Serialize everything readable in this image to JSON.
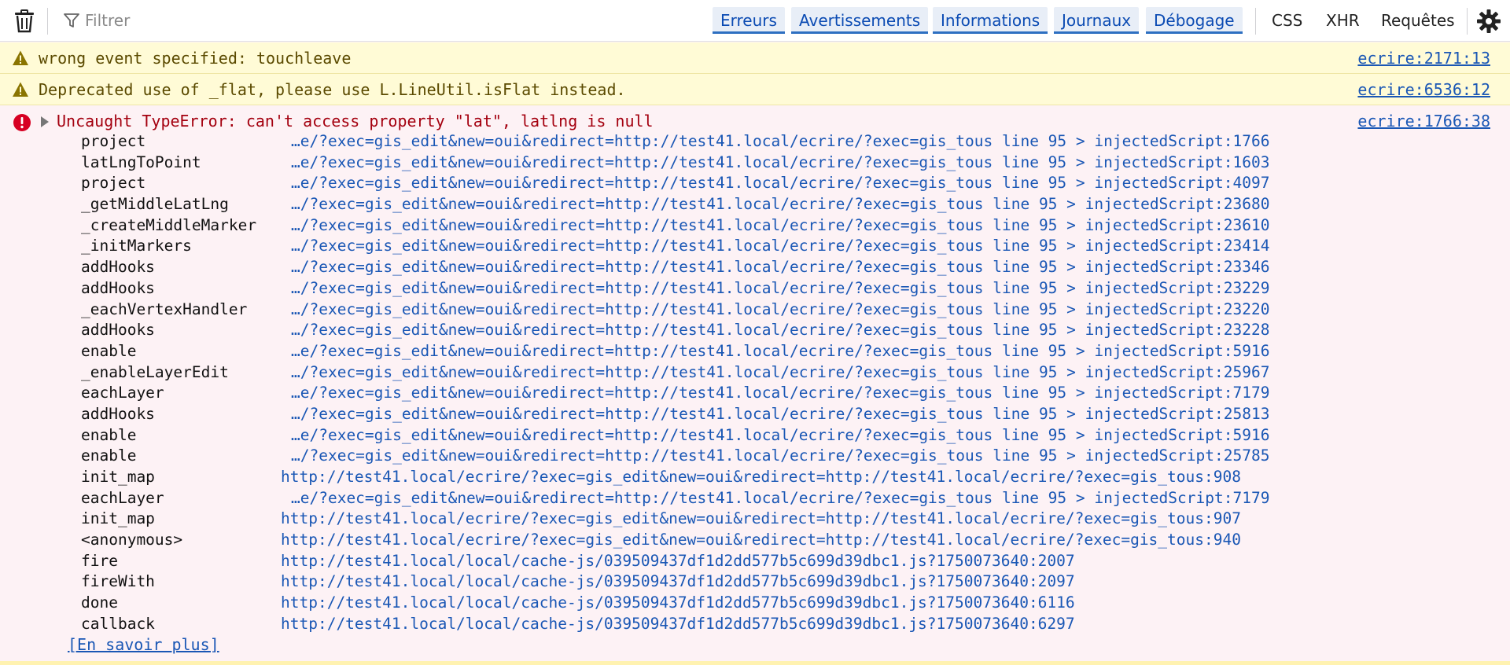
{
  "toolbar": {
    "filter_placeholder": "Filtrer",
    "tabs": [
      "Erreurs",
      "Avertissements",
      "Informations",
      "Journaux",
      "Débogage"
    ],
    "extras": [
      "CSS",
      "XHR",
      "Requêtes"
    ]
  },
  "messages": [
    {
      "type": "warning",
      "text": "wrong event specified: touchleave",
      "location": "ecrire:2171:13"
    },
    {
      "type": "warning",
      "text": "Deprecated use of _flat, please use L.LineUtil.isFlat instead.",
      "location": "ecrire:6536:12"
    }
  ],
  "error": {
    "text": "Uncaught TypeError: can't access property \"lat\", latlng is null",
    "location": "ecrire:1766:38",
    "frames": [
      {
        "fn": "project",
        "src": "…e/?exec=gis_edit&new=oui&redirect=http://test41.local/ecrire/?exec=gis_tous line 95 > injectedScript:1766"
      },
      {
        "fn": "latLngToPoint",
        "src": "…e/?exec=gis_edit&new=oui&redirect=http://test41.local/ecrire/?exec=gis_tous line 95 > injectedScript:1603"
      },
      {
        "fn": "project",
        "src": "…e/?exec=gis_edit&new=oui&redirect=http://test41.local/ecrire/?exec=gis_tous line 95 > injectedScript:4097"
      },
      {
        "fn": "_getMiddleLatLng",
        "src": "…/?exec=gis_edit&new=oui&redirect=http://test41.local/ecrire/?exec=gis_tous line 95 > injectedScript:23680"
      },
      {
        "fn": "_createMiddleMarker",
        "src": "…/?exec=gis_edit&new=oui&redirect=http://test41.local/ecrire/?exec=gis_tous line 95 > injectedScript:23610"
      },
      {
        "fn": "_initMarkers",
        "src": "…/?exec=gis_edit&new=oui&redirect=http://test41.local/ecrire/?exec=gis_tous line 95 > injectedScript:23414"
      },
      {
        "fn": "addHooks",
        "src": "…/?exec=gis_edit&new=oui&redirect=http://test41.local/ecrire/?exec=gis_tous line 95 > injectedScript:23346"
      },
      {
        "fn": "addHooks",
        "src": "…/?exec=gis_edit&new=oui&redirect=http://test41.local/ecrire/?exec=gis_tous line 95 > injectedScript:23229"
      },
      {
        "fn": "_eachVertexHandler",
        "src": "…/?exec=gis_edit&new=oui&redirect=http://test41.local/ecrire/?exec=gis_tous line 95 > injectedScript:23220"
      },
      {
        "fn": "addHooks",
        "src": "…/?exec=gis_edit&new=oui&redirect=http://test41.local/ecrire/?exec=gis_tous line 95 > injectedScript:23228"
      },
      {
        "fn": "enable",
        "src": "…e/?exec=gis_edit&new=oui&redirect=http://test41.local/ecrire/?exec=gis_tous line 95 > injectedScript:5916"
      },
      {
        "fn": "_enableLayerEdit",
        "src": "…/?exec=gis_edit&new=oui&redirect=http://test41.local/ecrire/?exec=gis_tous line 95 > injectedScript:25967"
      },
      {
        "fn": "eachLayer",
        "src": "…e/?exec=gis_edit&new=oui&redirect=http://test41.local/ecrire/?exec=gis_tous line 95 > injectedScript:7179"
      },
      {
        "fn": "addHooks",
        "src": "…/?exec=gis_edit&new=oui&redirect=http://test41.local/ecrire/?exec=gis_tous line 95 > injectedScript:25813"
      },
      {
        "fn": "enable",
        "src": "…e/?exec=gis_edit&new=oui&redirect=http://test41.local/ecrire/?exec=gis_tous line 95 > injectedScript:5916"
      },
      {
        "fn": "enable",
        "src": "…/?exec=gis_edit&new=oui&redirect=http://test41.local/ecrire/?exec=gis_tous line 95 > injectedScript:25785"
      },
      {
        "fn": "init_map",
        "src": "http://test41.local/ecrire/?exec=gis_edit&new=oui&redirect=http://test41.local/ecrire/?exec=gis_tous:908"
      },
      {
        "fn": "eachLayer",
        "src": "…e/?exec=gis_edit&new=oui&redirect=http://test41.local/ecrire/?exec=gis_tous line 95 > injectedScript:7179"
      },
      {
        "fn": "init_map",
        "src": "http://test41.local/ecrire/?exec=gis_edit&new=oui&redirect=http://test41.local/ecrire/?exec=gis_tous:907"
      },
      {
        "fn": "<anonymous>",
        "src": "http://test41.local/ecrire/?exec=gis_edit&new=oui&redirect=http://test41.local/ecrire/?exec=gis_tous:940"
      },
      {
        "fn": "fire",
        "src": "http://test41.local/local/cache-js/039509437df1d2dd577b5c699d39dbc1.js?1750073640:2007"
      },
      {
        "fn": "fireWith",
        "src": "http://test41.local/local/cache-js/039509437df1d2dd577b5c699d39dbc1.js?1750073640:2097"
      },
      {
        "fn": "done",
        "src": "http://test41.local/local/cache-js/039509437df1d2dd577b5c699d39dbc1.js?1750073640:6116"
      },
      {
        "fn": "callback",
        "src": "http://test41.local/local/cache-js/039509437df1d2dd577b5c699d39dbc1.js?1750073640:6297"
      }
    ],
    "learn_more": "[En savoir plus]"
  },
  "colors": {
    "warning_bg": "#fffbd6",
    "error_bg": "#fdf2f5",
    "error_text": "#a4000f",
    "link": "#1a57b5",
    "tab_active": "#2d6fc1"
  }
}
